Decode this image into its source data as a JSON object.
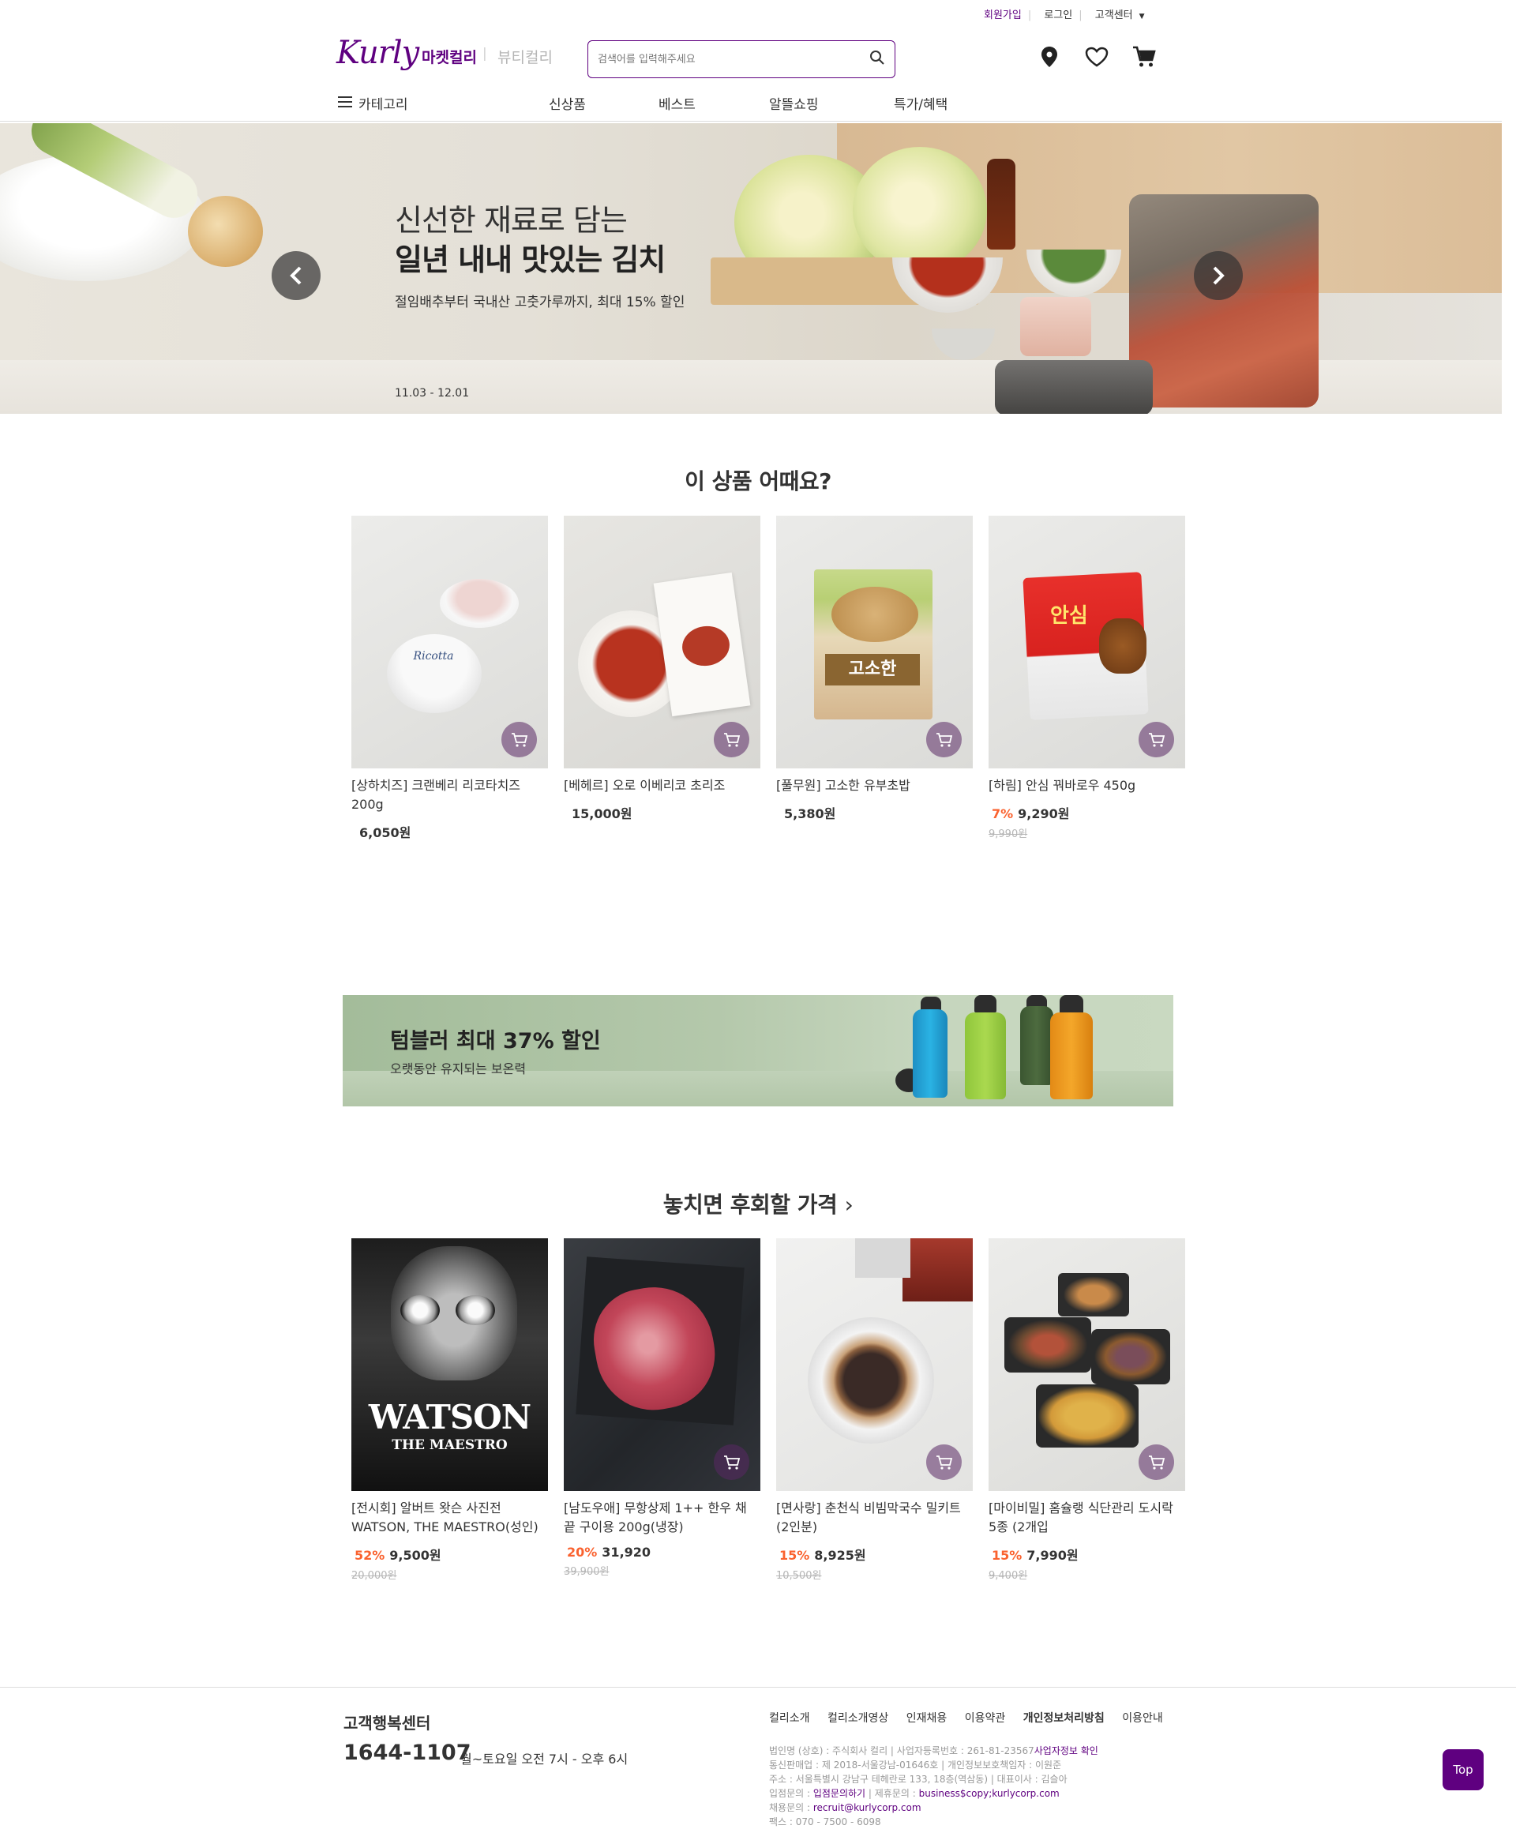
{
  "header": {
    "top_links": {
      "signup": "회원가입",
      "login": "로그인",
      "customer_center": "고객센터"
    },
    "logo": "Kurly",
    "tabs": {
      "market": "마켓컬리",
      "separator": "|",
      "beauty": "뷰티컬리"
    },
    "search": {
      "placeholder": "검색어를 입력해주세요",
      "value": ""
    },
    "nav": {
      "category": "카테고리",
      "items": [
        "신상품",
        "베스트",
        "알뜰쇼핑",
        "특가/혜택"
      ]
    },
    "icons": [
      "location-icon",
      "heart-icon",
      "cart-icon"
    ]
  },
  "banner": {
    "title_line1": "신선한 재료로 담는",
    "title_line2": "일년 내내 맛있는 김치",
    "subtitle": "절임배추부터 국내산 고춧가루까지, 최대 15% 할인",
    "date": "11.03 - 12.01"
  },
  "recommend": {
    "title": "이 상품 어때요?",
    "products": [
      {
        "name": "[상하치즈] 크랜베리 리코타치즈 200g",
        "price": "6,050원",
        "rate": "",
        "original": ""
      },
      {
        "name": "[베헤르] 오로 이베리코 초리조",
        "price": "15,000원",
        "rate": "",
        "original": ""
      },
      {
        "name": "[풀무원] 고소한 유부초밥",
        "price": "5,380원",
        "rate": "",
        "original": ""
      },
      {
        "name": "[하림] 안심 꿔바로우 450g",
        "price": "9,290원",
        "rate": "7%",
        "original": "9,990원"
      }
    ]
  },
  "tumbler_banner": {
    "title": "텀블러 최대 37% 할인",
    "subtitle": "오랫동안 유지되는 보온력"
  },
  "deals": {
    "title": "놓치면 후회할 가격",
    "products": [
      {
        "name": "[전시회] 알버트 왓슨 사진전 WATSON, THE MAESTRO(성인)",
        "price": "9,500원",
        "rate": "52%",
        "original": "20,000원",
        "poster_text": "WATSON",
        "poster_sub": "THE MAESTRO"
      },
      {
        "name": "[남도우애] 무항상제 1++ 한우 채끝 구이용 200g(냉장)",
        "price": "31,920",
        "rate": "20%",
        "original": "39,900원"
      },
      {
        "name": "[면사랑] 춘천식 비빔막국수 밀키트 (2인분)",
        "price": "8,925원",
        "rate": "15%",
        "original": "10,500원"
      },
      {
        "name": "[마이비밀] 홈슐랭 식단관리 도시락 5종 (2개입",
        "price": "7,990원",
        "rate": "15%",
        "original": "9,400원"
      }
    ]
  },
  "footer": {
    "cs_title": "고객행복센터",
    "phone": "1644-1107",
    "hours": "월~토요일 오전 7시 - 오후 6시",
    "links": [
      "컬리소개",
      "컬리소개영상",
      "인재채용",
      "이용약관",
      "개인정보처리방침",
      "이용안내"
    ],
    "info": [
      "법인명 (상호) : 주식회사 컬리 | 사업자등록번호 : 261-81-23567",
      "통신판매업 : 제 2018-서울강남-01646호 | 개인정보보호책임자 : 이원준",
      "주소 : 서울특별시 강남구 테헤란로 133, 18층(역삼동) | 대표이사 : 김슬아",
      "입점문의 : ",
      "채용문의 : ",
      "팩스 : 070 - 7500 - 6098"
    ],
    "info_links": {
      "business_check": "사업자정보 확인",
      "partner": "입점문의하기",
      "partner_sep": " | 제휴문의 : ",
      "partner_email": "business$copy;kurlycorp.com",
      "recruit_email": "recruit@kurlycorp.com"
    },
    "top_button": "Top"
  },
  "colors": {
    "brand": "#5f0080",
    "discount": "#fa622f"
  }
}
